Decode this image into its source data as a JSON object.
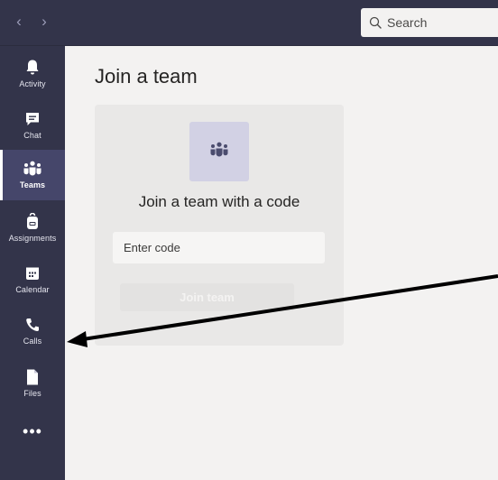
{
  "topbar": {
    "back_glyph": "‹",
    "forward_glyph": "›",
    "search_placeholder": "Search"
  },
  "sidebar": {
    "items": [
      {
        "label": "Activity",
        "icon": "bell-icon"
      },
      {
        "label": "Chat",
        "icon": "chat-icon"
      },
      {
        "label": "Teams",
        "icon": "teams-icon",
        "active": true
      },
      {
        "label": "Assignments",
        "icon": "backpack-icon"
      },
      {
        "label": "Calendar",
        "icon": "calendar-icon"
      },
      {
        "label": "Calls",
        "icon": "phone-icon"
      },
      {
        "label": "Files",
        "icon": "file-icon"
      }
    ],
    "more_label": "•••"
  },
  "main": {
    "page_title": "Join a team",
    "card": {
      "heading": "Join a team with a code",
      "input_placeholder": "Enter code",
      "button_label": "Join team"
    }
  },
  "colors": {
    "rail": "#33344a",
    "active_item": "#45466a",
    "content_bg": "#f3f2f1",
    "card_bg": "#e9e8e7",
    "tile_bg": "#d2d1e4"
  }
}
